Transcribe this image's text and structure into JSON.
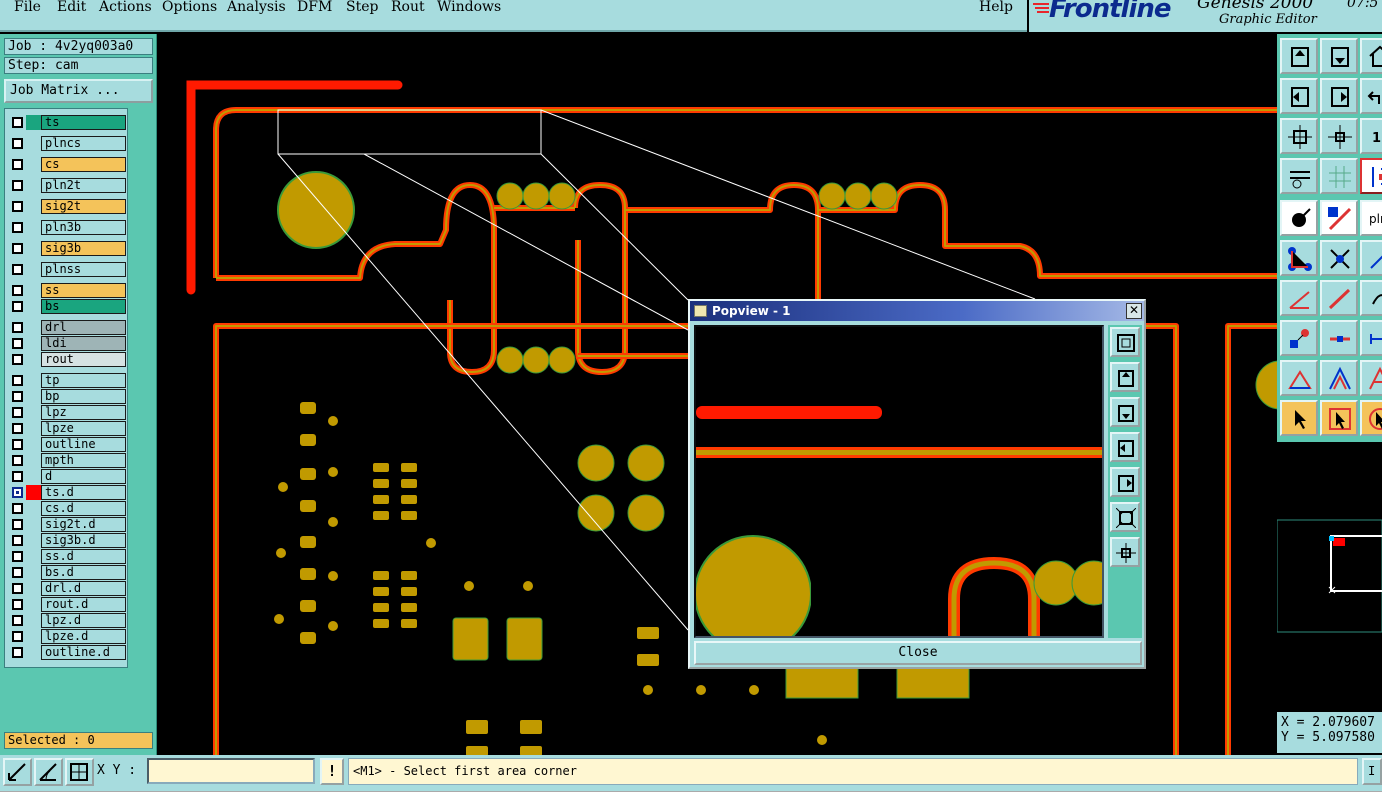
{
  "menu": {
    "items": [
      "File",
      "Edit",
      "Actions",
      "Options",
      "Analysis",
      "DFM",
      "Step",
      "Rout",
      "Windows"
    ],
    "help": "Help"
  },
  "brand": {
    "logo": "Frontline",
    "product": "Genesis 2000",
    "subtitle": "Graphic Editor",
    "clock": "07:5"
  },
  "job": {
    "job_label": "Job : 4v2yq003a0",
    "step_label": "Step: cam",
    "matrix_button": "Job Matrix ..."
  },
  "layers": [
    {
      "name": "ts",
      "color": "#1aa57f"
    },
    {
      "name": "plncs",
      "color": "#a7dcde"
    },
    {
      "name": "cs",
      "color": "#f4c35a"
    },
    {
      "name": "pln2t",
      "color": "#a7dcde"
    },
    {
      "name": "sig2t",
      "color": "#f4c35a"
    },
    {
      "name": "pln3b",
      "color": "#a7dcde"
    },
    {
      "name": "sig3b",
      "color": "#f4c35a"
    },
    {
      "name": "plnss",
      "color": "#a7dcde"
    },
    {
      "name": "ss",
      "color": "#f4c35a"
    },
    {
      "name": "bs",
      "color": "#1aa57f"
    },
    {
      "name": "drl",
      "color": "#9eb4b6"
    },
    {
      "name": "ldi",
      "color": "#9eb4b6"
    },
    {
      "name": "rout",
      "color": "#d6e2e3"
    },
    {
      "name": "tp",
      "color": "#a7dcde"
    },
    {
      "name": "bp",
      "color": "#a7dcde"
    },
    {
      "name": "lpz",
      "color": "#a7dcde"
    },
    {
      "name": "lpze",
      "color": "#a7dcde"
    },
    {
      "name": "outline",
      "color": "#a7dcde"
    },
    {
      "name": "mpth",
      "color": "#a7dcde"
    },
    {
      "name": "d",
      "color": "#a7dcde"
    },
    {
      "name": "ts.d",
      "color": "#a7dcde"
    },
    {
      "name": "cs.d",
      "color": "#a7dcde"
    },
    {
      "name": "sig2t.d",
      "color": "#a7dcde"
    },
    {
      "name": "sig3b.d",
      "color": "#a7dcde"
    },
    {
      "name": "ss.d",
      "color": "#a7dcde"
    },
    {
      "name": "bs.d",
      "color": "#a7dcde"
    },
    {
      "name": "drl.d",
      "color": "#a7dcde"
    },
    {
      "name": "rout.d",
      "color": "#a7dcde"
    },
    {
      "name": "lpz.d",
      "color": "#a7dcde"
    },
    {
      "name": "lpze.d",
      "color": "#a7dcde"
    },
    {
      "name": "outline.d",
      "color": "#a7dcde"
    }
  ],
  "selected_label": "Selected : 0",
  "coords": {
    "x": "X = 2.079607",
    "y": "Y = 5.097580"
  },
  "bottom": {
    "xy_label": "X Y :",
    "xy_value": "",
    "warn": "!",
    "prompt": "<M1> - Select first area corner",
    "info": "I"
  },
  "popview": {
    "title": "Popview - 1",
    "close_x": "✕",
    "close_button": "Close"
  },
  "colors": {
    "copper": "#c19a00",
    "trace_outline": "#ff3b00",
    "active_red": "#ff0000",
    "panel_teal": "#5bc7b0",
    "panel_light": "#a7dcde"
  }
}
